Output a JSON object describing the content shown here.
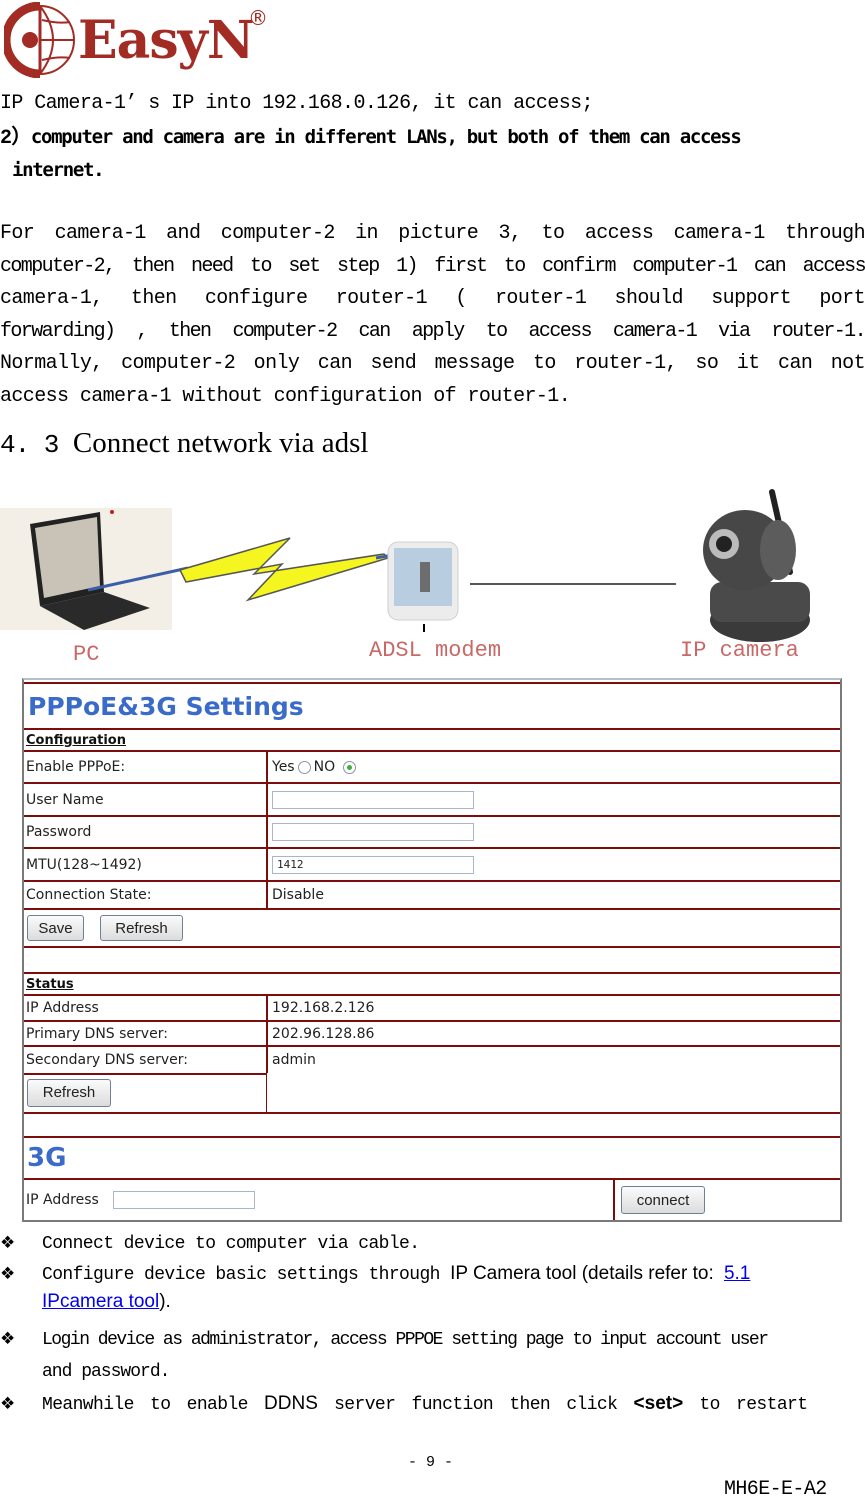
{
  "header": {
    "logo_text": "EasyN",
    "logo_registered": "®",
    "brand_color": "#a22b24"
  },
  "intro": {
    "line1": "IP Camera-1’ s IP into 192.168.0.126, it can access;",
    "item2_prefix": "2）",
    "item2_text_a": "computer and camera are in different LANs, but both of them can access",
    "item2_text_b": "internet."
  },
  "paragraph": {
    "lines": [
      "For camera-1 and computer-2 in picture 3, to access camera-1 through",
      "computer-2, then need to set step 1) first to confirm computer-1 can access",
      "camera-1, then configure router-1 ( router-1 should support port",
      "forwarding) , then computer-2 can apply to access camera-1 via router-1.",
      "Normally, computer-2 only can send message to router-1, so it can not",
      "access camera-1 without configuration of router-1."
    ]
  },
  "section": {
    "number": "4. 3",
    "title": "Connect network via adsl"
  },
  "diagram": {
    "labels": {
      "pc": "PC",
      "modem": "ADSL modem",
      "camera": "IP camera"
    }
  },
  "settings": {
    "title": "PPPoE&3G Settings",
    "accent_color": "#3a6bc8",
    "border_color": "#7b0d0d",
    "configuration": {
      "heading": "Configuration",
      "enable_label": "Enable PPPoE:",
      "yes_label": "Yes",
      "no_label": "NO",
      "enable_selected": "NO",
      "username_label": "User Name",
      "username_value": "",
      "password_label": "Password",
      "password_value": "",
      "mtu_label": "MTU(128~1492)",
      "mtu_value": "1412",
      "state_label": "Connection State:",
      "state_value": "Disable",
      "save_button": "Save",
      "refresh_button": "Refresh"
    },
    "status": {
      "heading": "Status",
      "rows": [
        {
          "label": "IP Address",
          "value": "192.168.2.126"
        },
        {
          "label": "Primary DNS server:",
          "value": "202.96.128.86"
        },
        {
          "label": "Secondary DNS server:",
          "value": "admin"
        }
      ],
      "refresh_button": "Refresh"
    },
    "g3": {
      "title": "3G",
      "ip_label": "IP Address",
      "ip_value": "",
      "connect_button": "connect"
    }
  },
  "bullets": {
    "b1": "Connect device to computer via cable.",
    "b2_a": "Configure device basic settings through",
    "b2_b": "IP Camera tool (details refer to:",
    "b2_link1": "5.1",
    "b2_link2": "IPcamera tool",
    "b2_end": ").",
    "b3_a": "Login device as administrator, access PPPOE setting page to input account user",
    "b3_b": "and password.",
    "b4_a": "Meanwhile to enable",
    "b4_ddns": "DDNS",
    "b4_b": "server function then click",
    "b4_set": "<set>",
    "b4_c": "to restart"
  },
  "footer": {
    "page_number": "- 9 -",
    "doc_code": "MH6E-E-A2"
  }
}
